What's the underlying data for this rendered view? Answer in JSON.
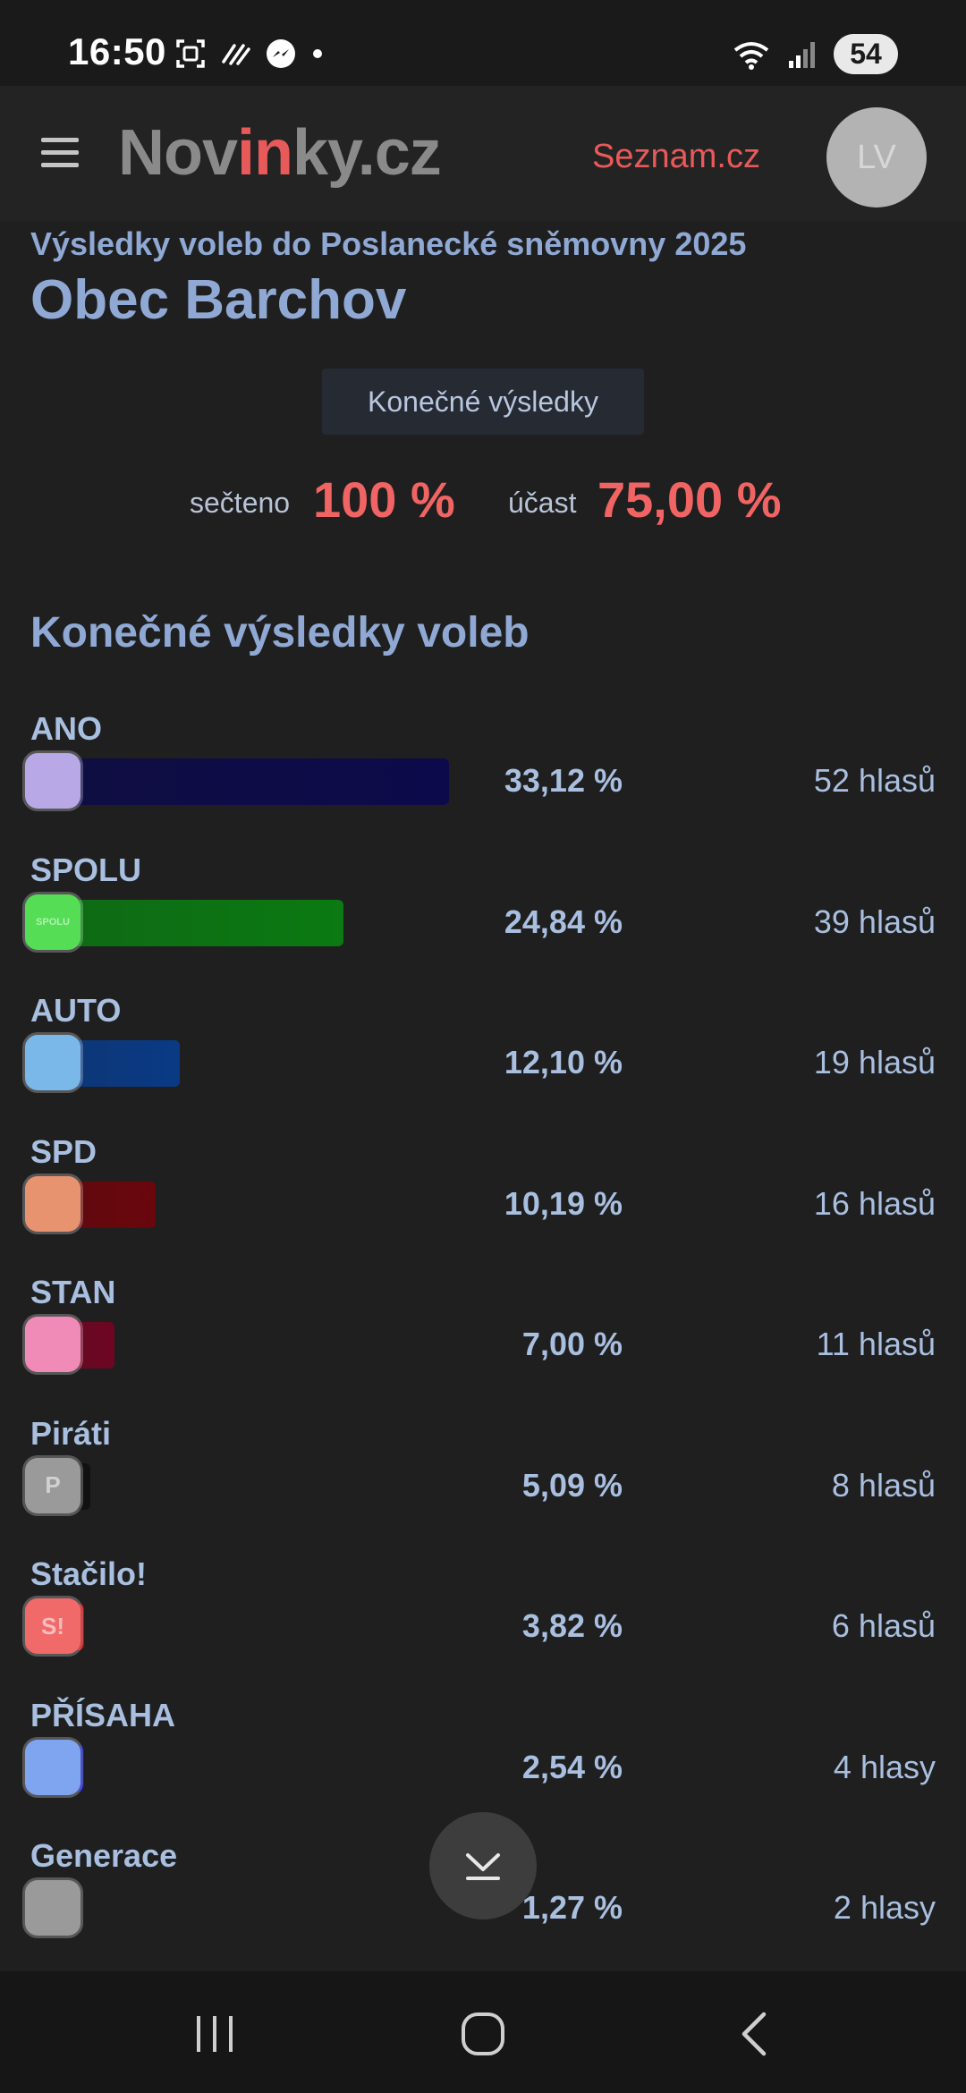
{
  "status_bar": {
    "time": "16:50",
    "battery": "54",
    "icons_left": [
      "screenshot-icon",
      "wifi-calling-icon",
      "messenger-icon",
      "dot-icon"
    ],
    "icons_right": [
      "wifi-icon",
      "signal-icon"
    ]
  },
  "header": {
    "logo_prefix": "Nov",
    "logo_accent": "in",
    "logo_suffix": "ky.cz",
    "seznam_link": "Seznam.cz",
    "avatar_initials": "LV"
  },
  "page": {
    "subtitle": "Výsledky voleb do Poslanecké sněmovny 2025",
    "title": "Obec Barchov",
    "chip": "Konečné výsledky",
    "counted_label": "sečteno",
    "counted_value": "100 %",
    "turnout_label": "účast",
    "turnout_value": "75,00 %",
    "section_heading": "Konečné výsledky voleb"
  },
  "colors": {
    "accent_red": "#f06464",
    "heading_blue": "#8fa9d4"
  },
  "chart_data": {
    "type": "bar",
    "categories": [
      "ANO",
      "SPOLU",
      "AUTO",
      "SPD",
      "STAN",
      "Piráti",
      "Stačilo!",
      "PŘÍSAHA",
      "Generace"
    ],
    "values": [
      33.12,
      24.84,
      12.1,
      10.19,
      7.0,
      5.09,
      3.82,
      2.54,
      1.27
    ],
    "percent_labels": [
      "33,12 %",
      "24,84 %",
      "12,10 %",
      "10,19 %",
      "7,00 %",
      "5,09 %",
      "3,82 %",
      "2,54 %",
      "1,27 %"
    ],
    "votes_labels": [
      "52 hlasů",
      "39 hlasů",
      "19 hlasů",
      "16 hlasů",
      "11 hlasů",
      "8 hlasů",
      "6 hlasů",
      "4 hlasy",
      "2 hlasy"
    ],
    "bar_colors": [
      "#0c0a4a",
      "#0b7a12",
      "#0a3a85",
      "#6a060d",
      "#6e0622",
      "#111111",
      "#b50d0d",
      "#1216a8",
      "#222222"
    ],
    "logo_colors": [
      "#b9a8e6",
      "#55dd55",
      "#79b8e8",
      "#e8936f",
      "#f08bb8",
      "#9a9a9a",
      "#f06a6a",
      "#7fa4f0",
      "#9a9a9a"
    ],
    "logo_marks": [
      "",
      "SPOLU",
      "",
      "",
      "",
      "P",
      "S!",
      "",
      ""
    ]
  }
}
